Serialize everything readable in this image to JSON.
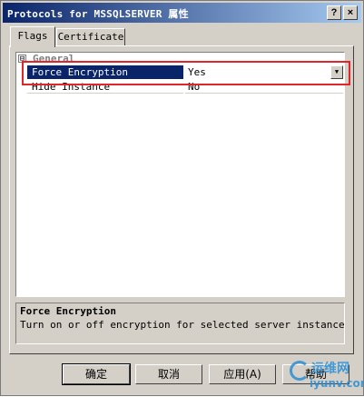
{
  "window": {
    "title": "Protocols for MSSQLSERVER 属性",
    "help_glyph": "?",
    "close_glyph": "×"
  },
  "tabs": [
    {
      "label": "Flags"
    },
    {
      "label": "Certificate"
    }
  ],
  "grid": {
    "category_label": "General",
    "expander_glyph": "⊟",
    "rows": [
      {
        "name": "Force Encryption",
        "value": "Yes"
      },
      {
        "name": "Hide Instance",
        "value": "No"
      }
    ],
    "dropdown_glyph": "▼"
  },
  "description": {
    "title": "Force Encryption",
    "text": "Turn on or off encryption for selected server instance"
  },
  "buttons": {
    "ok": "确定",
    "cancel": "取消",
    "apply": "应用(A)",
    "help": "帮助"
  },
  "watermark": {
    "cn": "运维网",
    "en": "iyunv.com"
  },
  "colors": {
    "highlight_box": "#e0262b",
    "selection": "#0a246a",
    "titlebar": "#0a246a"
  }
}
